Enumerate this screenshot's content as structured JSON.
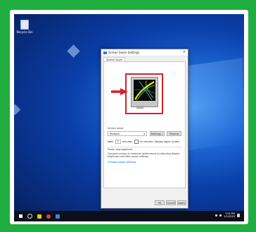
{
  "desktop": {
    "recycle_bin_label": "Recycle Bin"
  },
  "dialog": {
    "title": "Screen Saver Settings",
    "close_glyph": "×",
    "tab_label": "Screen Saver",
    "screen_saver_section_label": "Screen saver",
    "screen_saver_selected": "Ribbons",
    "settings_button": "Settings...",
    "preview_button": "Preview",
    "wait_label": "Wait:",
    "wait_value": "1",
    "minutes_label": "minutes",
    "resume_label": "On resume, display logon screen",
    "power_section_label": "Power management",
    "power_description": "Conserve energy or maximize performance by adjusting display brightness and other power settings.",
    "power_link": "Change power settings",
    "ok_button": "OK",
    "cancel_button": "Cancel",
    "apply_button": "Apply"
  },
  "taskbar": {
    "clock_time": "7:00 PM",
    "clock_date": "1/1/2020"
  },
  "colors": {
    "frame_border": "#1fae3f",
    "highlight_red": "#d9202a",
    "link_blue": "#0066cc"
  }
}
